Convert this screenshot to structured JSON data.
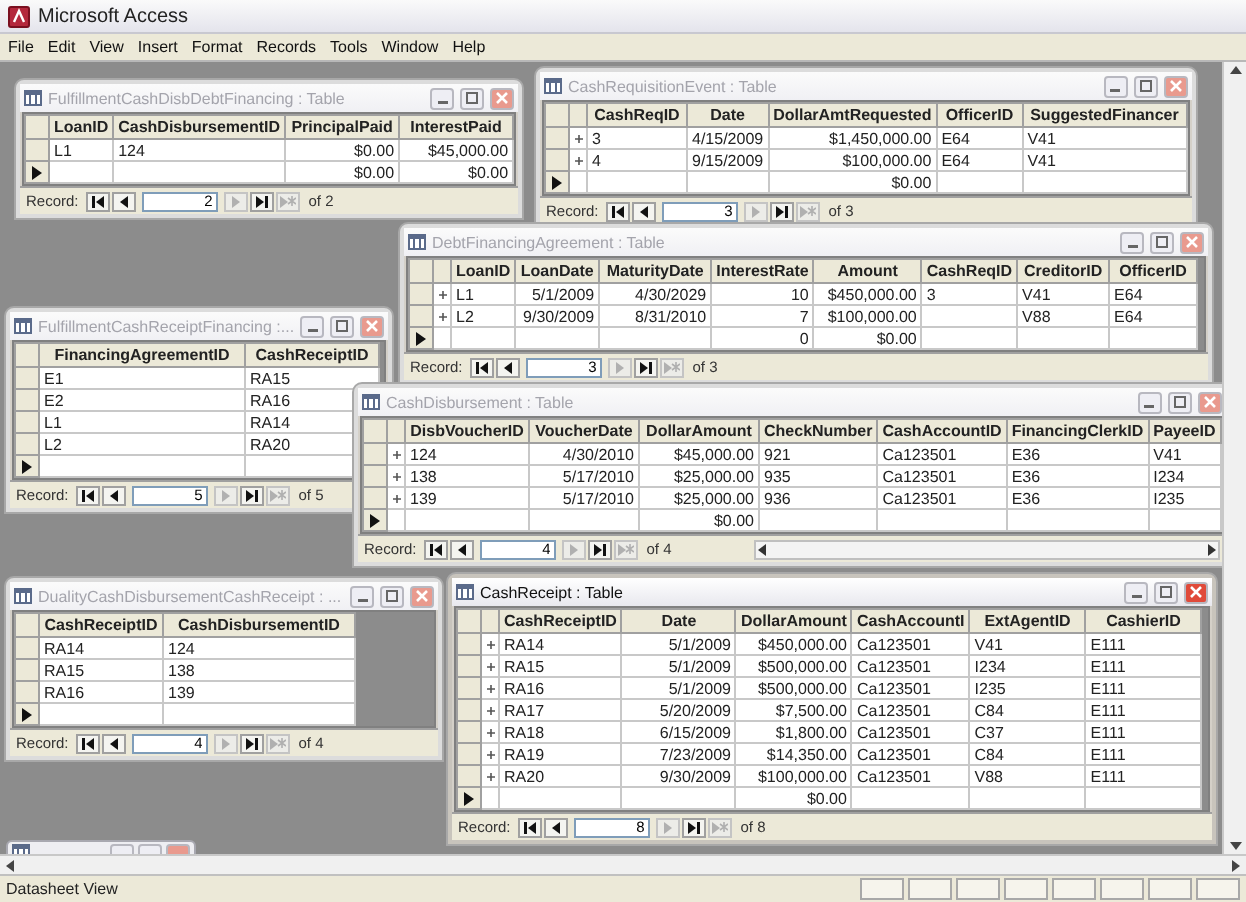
{
  "window": {
    "title": "Microsoft Access"
  },
  "menu": [
    "File",
    "Edit",
    "View",
    "Insert",
    "Format",
    "Records",
    "Tools",
    "Window",
    "Help"
  ],
  "windows": [
    {
      "title": "FulfillmentCashDisbDebtFinancing : Table",
      "active": false,
      "columns": [
        {
          "name": "LoanID",
          "kind": "text"
        },
        {
          "name": "CashDisbursementID",
          "kind": "text"
        },
        {
          "name": "PrincipalPaid",
          "kind": "number"
        },
        {
          "name": "InterestPaid",
          "kind": "number"
        }
      ],
      "rows": [
        {
          "cells": [
            "L1",
            "124",
            "$0.00",
            "$45,000.00"
          ],
          "current": false
        },
        {
          "cells": [
            null,
            null,
            "$0.00",
            "$0.00"
          ],
          "current": true
        }
      ],
      "record": {
        "label": "Record:",
        "value": "2",
        "total": "of 2"
      },
      "nav": [
        {
          "kind": "first",
          "disabled": false
        },
        {
          "kind": "prev",
          "disabled": false
        },
        {
          "kind": "next",
          "disabled": true
        },
        {
          "kind": "last",
          "disabled": false
        },
        {
          "kind": "new",
          "disabled": true
        }
      ]
    },
    {
      "title": "CashRequisitionEvent : Table",
      "active": false,
      "columns": [
        {
          "name": "CashReqID",
          "kind": "text"
        },
        {
          "name": "Date",
          "kind": "number"
        },
        {
          "name": "DollarAmtRequested",
          "kind": "number"
        },
        {
          "name": "OfficerID",
          "kind": "text"
        },
        {
          "name": "SuggestedFinancer",
          "kind": "text"
        }
      ],
      "rows": [
        {
          "cells": [
            "3",
            "4/15/2009",
            "$1,450,000.00",
            "E64",
            "V41"
          ],
          "current": false,
          "expandable": true
        },
        {
          "cells": [
            "4",
            "9/15/2009",
            "$100,000.00",
            "E64",
            "V41"
          ],
          "current": false,
          "expandable": true
        },
        {
          "cells": [
            null,
            null,
            "$0.00",
            null,
            null
          ],
          "current": true,
          "expandable": false
        }
      ],
      "record": {
        "label": "Record:",
        "value": "3",
        "total": "of 3"
      },
      "nav": [
        {
          "kind": "first",
          "disabled": false
        },
        {
          "kind": "prev",
          "disabled": false
        },
        {
          "kind": "next",
          "disabled": true
        },
        {
          "kind": "last",
          "disabled": false
        },
        {
          "kind": "new",
          "disabled": true
        }
      ]
    },
    {
      "title": "DebtFinancingAgreement : Table",
      "active": false,
      "columns": [
        {
          "name": "LoanID",
          "kind": "text"
        },
        {
          "name": "LoanDate",
          "kind": "number"
        },
        {
          "name": "MaturityDate",
          "kind": "number"
        },
        {
          "name": "InterestRate",
          "kind": "number"
        },
        {
          "name": "Amount",
          "kind": "number"
        },
        {
          "name": "CashReqID",
          "kind": "text"
        },
        {
          "name": "CreditorID",
          "kind": "text"
        },
        {
          "name": "OfficerID",
          "kind": "text"
        }
      ],
      "rows": [
        {
          "cells": [
            "L1",
            "5/1/2009",
            "4/30/2029",
            "10",
            "$450,000.00",
            "3",
            "V41",
            "E64"
          ],
          "current": false,
          "expandable": true
        },
        {
          "cells": [
            "L2",
            "9/30/2009",
            "8/31/2010",
            "7",
            "$100,000.00",
            null,
            "V88",
            "E64"
          ],
          "current": false,
          "expandable": true
        },
        {
          "cells": [
            null,
            null,
            null,
            "0",
            "$0.00",
            null,
            null,
            null
          ],
          "current": true,
          "expandable": false
        }
      ],
      "record": {
        "label": "Record:",
        "value": "3",
        "total": "of 3"
      },
      "nav": [
        {
          "kind": "first",
          "disabled": false
        },
        {
          "kind": "prev",
          "disabled": false
        },
        {
          "kind": "next",
          "disabled": true
        },
        {
          "kind": "last",
          "disabled": false
        },
        {
          "kind": "new",
          "disabled": true
        }
      ]
    },
    {
      "title": "FulfillmentCashReceiptFinancing :...",
      "active": false,
      "columns": [
        {
          "name": "FinancingAgreementID",
          "kind": "text"
        },
        {
          "name": "CashReceiptID",
          "kind": "text"
        }
      ],
      "rows": [
        {
          "cells": [
            "E1",
            "RA15"
          ],
          "current": false
        },
        {
          "cells": [
            "E2",
            "RA16"
          ],
          "current": false
        },
        {
          "cells": [
            "L1",
            "RA14"
          ],
          "current": false
        },
        {
          "cells": [
            "L2",
            "RA20"
          ],
          "current": false
        },
        {
          "cells": [
            null,
            null
          ],
          "current": true
        }
      ],
      "record": {
        "label": "Record:",
        "value": "5",
        "total": "of 5"
      },
      "nav": [
        {
          "kind": "first",
          "disabled": false
        },
        {
          "kind": "prev",
          "disabled": false
        },
        {
          "kind": "next",
          "disabled": true
        },
        {
          "kind": "last",
          "disabled": false
        },
        {
          "kind": "new",
          "disabled": true
        }
      ]
    },
    {
      "title": "CashDisbursement : Table",
      "active": false,
      "horizontal_scrollbar": true,
      "columns": [
        {
          "name": "DisbVoucherID",
          "kind": "text"
        },
        {
          "name": "VoucherDate",
          "kind": "number"
        },
        {
          "name": "DollarAmount",
          "kind": "number"
        },
        {
          "name": "CheckNumber",
          "kind": "text"
        },
        {
          "name": "CashAccountID",
          "kind": "text"
        },
        {
          "name": "FinancingClerkID",
          "kind": "text"
        },
        {
          "name": "PayeeID",
          "kind": "text"
        }
      ],
      "rows": [
        {
          "cells": [
            "124",
            "4/30/2010",
            "$45,000.00",
            "921",
            "Ca123501",
            "E36",
            "V41"
          ],
          "current": false,
          "expandable": true
        },
        {
          "cells": [
            "138",
            "5/17/2010",
            "$25,000.00",
            "935",
            "Ca123501",
            "E36",
            "I234"
          ],
          "current": false,
          "expandable": true
        },
        {
          "cells": [
            "139",
            "5/17/2010",
            "$25,000.00",
            "936",
            "Ca123501",
            "E36",
            "I235"
          ],
          "current": false,
          "expandable": true
        },
        {
          "cells": [
            null,
            null,
            "$0.00",
            null,
            null,
            null,
            null
          ],
          "current": true,
          "expandable": false
        }
      ],
      "record": {
        "label": "Record:",
        "value": "4",
        "total": "of 4"
      },
      "nav": [
        {
          "kind": "first",
          "disabled": false
        },
        {
          "kind": "prev",
          "disabled": false
        },
        {
          "kind": "next",
          "disabled": true
        },
        {
          "kind": "last",
          "disabled": false
        },
        {
          "kind": "new",
          "disabled": true
        }
      ]
    },
    {
      "title": "DualityCashDisbursementCashReceipt : ...",
      "active": false,
      "columns": [
        {
          "name": "CashReceiptID",
          "kind": "text"
        },
        {
          "name": "CashDisbursementID",
          "kind": "text"
        }
      ],
      "rows": [
        {
          "cells": [
            "RA14",
            "124"
          ],
          "current": false
        },
        {
          "cells": [
            "RA15",
            "138"
          ],
          "current": false
        },
        {
          "cells": [
            "RA16",
            "139"
          ],
          "current": false
        },
        {
          "cells": [
            null,
            null
          ],
          "current": true
        }
      ],
      "record": {
        "label": "Record:",
        "value": "4",
        "total": "of 4"
      },
      "nav": [
        {
          "kind": "first",
          "disabled": false
        },
        {
          "kind": "prev",
          "disabled": false
        },
        {
          "kind": "next",
          "disabled": true
        },
        {
          "kind": "last",
          "disabled": false
        },
        {
          "kind": "new",
          "disabled": true
        }
      ]
    },
    {
      "title": "CashReceipt : Table",
      "active": true,
      "columns": [
        {
          "name": "CashReceiptID",
          "kind": "text"
        },
        {
          "name": "Date",
          "kind": "number"
        },
        {
          "name": "DollarAmount",
          "kind": "number"
        },
        {
          "name": "CashAccountI",
          "kind": "text"
        },
        {
          "name": "ExtAgentID",
          "kind": "text"
        },
        {
          "name": "CashierID",
          "kind": "text"
        }
      ],
      "rows": [
        {
          "cells": [
            "RA14",
            "5/1/2009",
            "$450,000.00",
            "Ca123501",
            "V41",
            "E111"
          ],
          "current": false,
          "expandable": true
        },
        {
          "cells": [
            "RA15",
            "5/1/2009",
            "$500,000.00",
            "Ca123501",
            "I234",
            "E111"
          ],
          "current": false,
          "expandable": true
        },
        {
          "cells": [
            "RA16",
            "5/1/2009",
            "$500,000.00",
            "Ca123501",
            "I235",
            "E111"
          ],
          "current": false,
          "expandable": true
        },
        {
          "cells": [
            "RA17",
            "5/20/2009",
            "$7,500.00",
            "Ca123501",
            "C84",
            "E111"
          ],
          "current": false,
          "expandable": true
        },
        {
          "cells": [
            "RA18",
            "6/15/2009",
            "$1,800.00",
            "Ca123501",
            "C37",
            "E111"
          ],
          "current": false,
          "expandable": true
        },
        {
          "cells": [
            "RA19",
            "7/23/2009",
            "$14,350.00",
            "Ca123501",
            "C84",
            "E111"
          ],
          "current": false,
          "expandable": true
        },
        {
          "cells": [
            "RA20",
            "9/30/2009",
            "$100,000.00",
            "Ca123501",
            "V88",
            "E111"
          ],
          "current": false,
          "expandable": true
        },
        {
          "cells": [
            null,
            null,
            "$0.00",
            null,
            null,
            null
          ],
          "current": true,
          "expandable": false
        }
      ],
      "record": {
        "label": "Record:",
        "value": "8",
        "total": "of 8"
      },
      "nav": [
        {
          "kind": "first",
          "disabled": false
        },
        {
          "kind": "prev",
          "disabled": false
        },
        {
          "kind": "next",
          "disabled": true
        },
        {
          "kind": "last",
          "disabled": false
        },
        {
          "kind": "new",
          "disabled": true
        }
      ]
    }
  ],
  "status_bar": {
    "text": "Datasheet View"
  }
}
